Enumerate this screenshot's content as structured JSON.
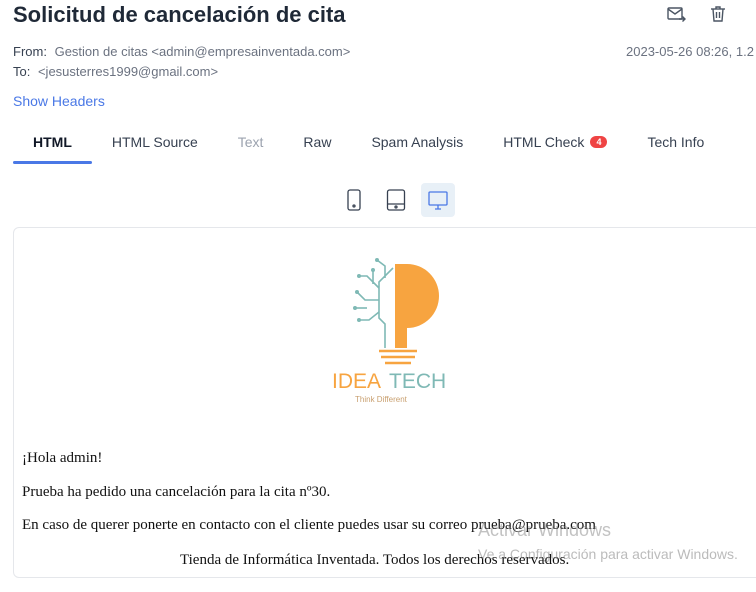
{
  "email": {
    "subject": "Solicitud de cancelación de cita",
    "from_label": "From:",
    "from_value": "Gestion de citas <admin@empresainventada.com>",
    "to_label": "To:",
    "to_value": "<jesusterres1999@gmail.com>",
    "date": "2023-05-26 08:26, 1.2",
    "show_headers": "Show Headers"
  },
  "actions": {
    "icons": [
      "forward-mail-icon",
      "trash-icon"
    ]
  },
  "tabs": [
    {
      "label": "HTML",
      "state": "active"
    },
    {
      "label": "HTML Source",
      "state": "normal"
    },
    {
      "label": "Text",
      "state": "disabled"
    },
    {
      "label": "Raw",
      "state": "normal"
    },
    {
      "label": "Spam Analysis",
      "state": "normal"
    },
    {
      "label": "HTML Check",
      "state": "normal",
      "badge": "4"
    },
    {
      "label": "Tech Info",
      "state": "normal"
    }
  ],
  "device_toggle": {
    "options": [
      "mobile-icon",
      "tablet-icon",
      "desktop-icon"
    ],
    "selected": "desktop-icon"
  },
  "preview": {
    "logo": {
      "text_idea": "IDEA",
      "text_tech": "TECH",
      "tagline": "Think Different",
      "orange": "#f7a440",
      "teal": "#7fb9b5"
    },
    "greeting": "¡Hola admin!",
    "line1": "Prueba ha pedido una cancelación para la cita nº30.",
    "line2": "En caso de querer ponerte en contacto con el cliente puedes usar su correo prueba@prueba.com",
    "footer": "Tienda de Informática Inventada. Todos los derechos reservados."
  },
  "watermark": {
    "line1": "Activar Windows",
    "line2": "Ve a Configuración para activar Windows."
  },
  "colors": {
    "accent": "#4a78e6",
    "badge": "#ef4444",
    "text": "#1f2937",
    "muted": "#6b7280"
  }
}
